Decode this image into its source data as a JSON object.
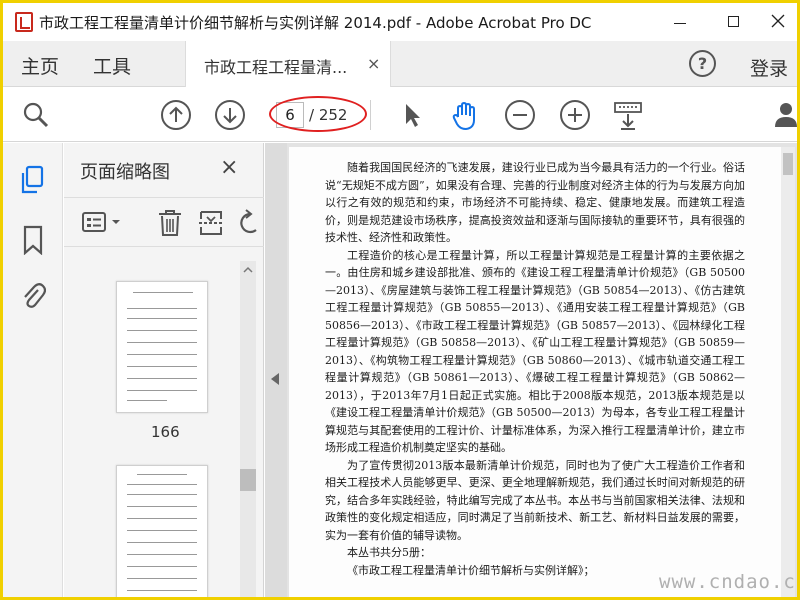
{
  "window": {
    "title": "市政工程工程量清单计价细节解析与实例详解 2014.pdf - Adobe Acrobat Pro DC",
    "minimize_icon": "minimize-icon",
    "maximize_icon": "maximize-icon",
    "close_icon": "close-icon",
    "frame_color": "#f0d000"
  },
  "menubar": {
    "home": "主页",
    "tools": "工具",
    "tab_label": "市政工程工程量清...",
    "tab_close": "×",
    "help_glyph": "?",
    "login": "登录"
  },
  "toolbar": {
    "current_page": "6",
    "total_pages": "/ 252",
    "icons": [
      "search-zoom-icon",
      "page-up-icon",
      "page-down-icon",
      "select-arrow-icon",
      "hand-tool-icon",
      "zoom-out-icon",
      "zoom-in-icon",
      "keyboard-icon",
      "user-icon"
    ],
    "highlight_color": "#e02020"
  },
  "rail": {
    "icons": [
      "page-thumbnails-icon",
      "bookmark-icon",
      "attachment-icon"
    ],
    "accent_color": "#1473e6"
  },
  "thumbnails": {
    "title": "页面缩略图",
    "close": "×",
    "tool_icons": [
      "thumbnail-options-icon",
      "delete-icon",
      "insert-page-icon",
      "rotate-icon"
    ],
    "page_label": "166"
  },
  "document": {
    "paragraphs": [
      "随着我国国民经济的飞速发展，建设行业已成为当今最具有活力的一个行业。俗话说“无规矩不成方圆”，如果没有合理、完善的行业制度对经济主体的行为与发展方向加以行之有效的规范和约束，市场经济不可能持续、稳定、健康地发展。而建筑工程造价，则是规范建设市场秩序，提高投资效益和逐渐与国际接轨的重要环节，具有很强的技术性、经济性和政策性。",
      "工程造价的核心是工程量计算，所以工程量计算规范是工程量计算的主要依据之一。由住房和城乡建设部批准、颁布的《建设工程工程量清单计价规范》（GB 50500—2013）、《房屋建筑与装饰工程工程量计算规范》（GB 50854—2013）、《仿古建筑工程工程量计算规范》（GB 50855—2013）、《通用安装工程工程量计算规范》（GB 50856—2013）、《市政工程工程量计算规范》（GB 50857—2013）、《园林绿化工程工程量计算规范》（GB 50858—2013）、《矿山工程工程量计算规范》（GB 50859—2013）、《构筑物工程工程量计算规范》（GB 50860—2013）、《城市轨道交通工程工程量计算规范》（GB 50861—2013）、《爆破工程工程量计算规范》（GB 50862—2013），于2013年7月1日起正式实施。相比于2008版本规范，2013版本规范是以《建设工程工程量清单计价规范》（GB 50500—2013）为母本，各专业工程工程量计算规范与其配套使用的工程计价、计量标准体系，为深入推行工程量清单计价，建立市场形成工程造价机制奠定坚实的基础。",
      "为了宣传贯彻2013版本最新清单计价规范，同时也为了使广大工程造价工作者和相关工程技术人员能够更早、更深、更全地理解新规范，我们通过长时间对新规范的研究，结合多年实践经验，特此编写完成了本丛书。本丛书与当前国家相关法律、法规和政策性的变化规定相适应，同时满足了当前新技术、新工艺、新材料日益发展的需要，实为一套有价值的辅导读物。",
      "本丛书共分5册：",
      "《市政工程工程量清单计价细节解析与实例详解》；"
    ],
    "watermark": "www.cndao.com"
  }
}
